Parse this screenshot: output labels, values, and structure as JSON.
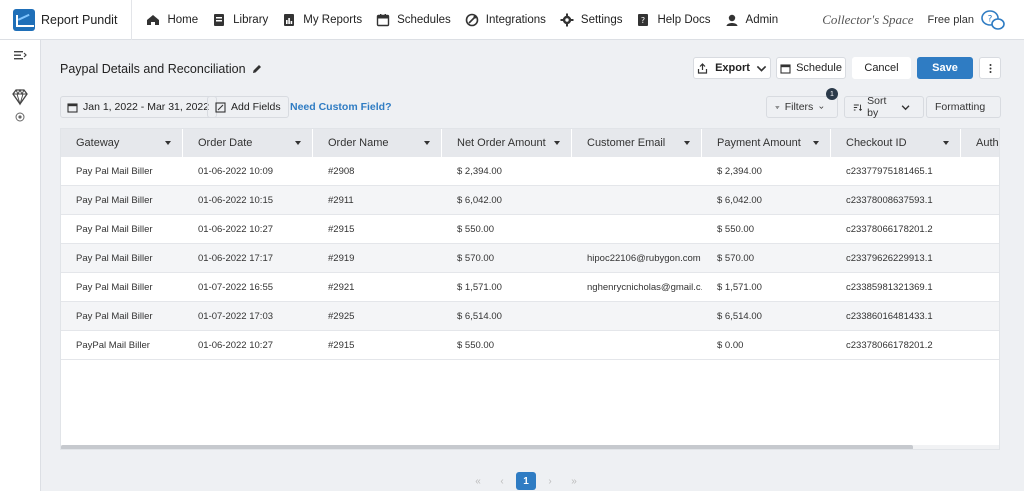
{
  "brand": {
    "name": "Report Pundit"
  },
  "nav": [
    {
      "label": "Home",
      "icon": "home-icon"
    },
    {
      "label": "Library",
      "icon": "library-icon"
    },
    {
      "label": "My Reports",
      "icon": "reports-icon"
    },
    {
      "label": "Schedules",
      "icon": "calendar-icon"
    },
    {
      "label": "Integrations",
      "icon": "integrations-icon"
    },
    {
      "label": "Settings",
      "icon": "gear-icon"
    },
    {
      "label": "Help Docs",
      "icon": "help-docs-icon"
    },
    {
      "label": "Admin",
      "icon": "admin-icon"
    }
  ],
  "workspace": "Collector's Space",
  "plan": "Free plan",
  "report": {
    "title": "Paypal Details and Reconciliation",
    "export_label": "Export",
    "schedule_label": "Schedule",
    "cancel_label": "Cancel",
    "save_label": "Save"
  },
  "toolbar": {
    "date_range": "Jan 1, 2022 - Mar 31, 2022",
    "add_fields": "Add Fields",
    "custom_field_link": "Need Custom Field?",
    "filters": "Filters",
    "filter_count": "1",
    "sort_by": "Sort by",
    "formatting": "Formatting"
  },
  "table": {
    "columns": [
      "Gateway",
      "Order Date",
      "Order Name",
      "Net Order Amount",
      "Customer Email",
      "Payment Amount",
      "Checkout ID",
      "Auth"
    ],
    "rows": [
      [
        "Pay Pal Mail Biller",
        "01-06-2022 10:09",
        "#2908",
        "$ 2,394.00",
        "",
        "$ 2,394.00",
        "c23377975181465.1",
        ""
      ],
      [
        "Pay Pal Mail Biller",
        "01-06-2022 10:15",
        "#2911",
        "$ 6,042.00",
        "",
        "$ 6,042.00",
        "c23378008637593.1",
        ""
      ],
      [
        "Pay Pal Mail Biller",
        "01-06-2022 10:27",
        "#2915",
        "$ 550.00",
        "",
        "$ 550.00",
        "c23378066178201.2",
        ""
      ],
      [
        "Pay Pal Mail Biller",
        "01-06-2022 17:17",
        "#2919",
        "$ 570.00",
        "hipoc22106@rubygon.com",
        "$ 570.00",
        "c23379626229913.1",
        ""
      ],
      [
        "Pay Pal Mail Biller",
        "01-07-2022 16:55",
        "#2921",
        "$ 1,571.00",
        "nghenrycnicholas@gmail.c...",
        "$ 1,571.00",
        "c23385981321369.1",
        ""
      ],
      [
        "Pay Pal Mail Biller",
        "01-07-2022 17:03",
        "#2925",
        "$ 6,514.00",
        "",
        "$ 6,514.00",
        "c23386016481433.1",
        ""
      ],
      [
        "PayPal Mail Biller",
        "01-06-2022 10:27",
        "#2915",
        "$ 550.00",
        "",
        "$ 0.00",
        "c23378066178201.2",
        ""
      ]
    ]
  },
  "pagination": {
    "first": "«",
    "prev": "‹",
    "current": "1",
    "next": "›",
    "last": "»"
  },
  "colors": {
    "accent": "#2f7cc3",
    "header_bg": "#e6e8ec"
  }
}
